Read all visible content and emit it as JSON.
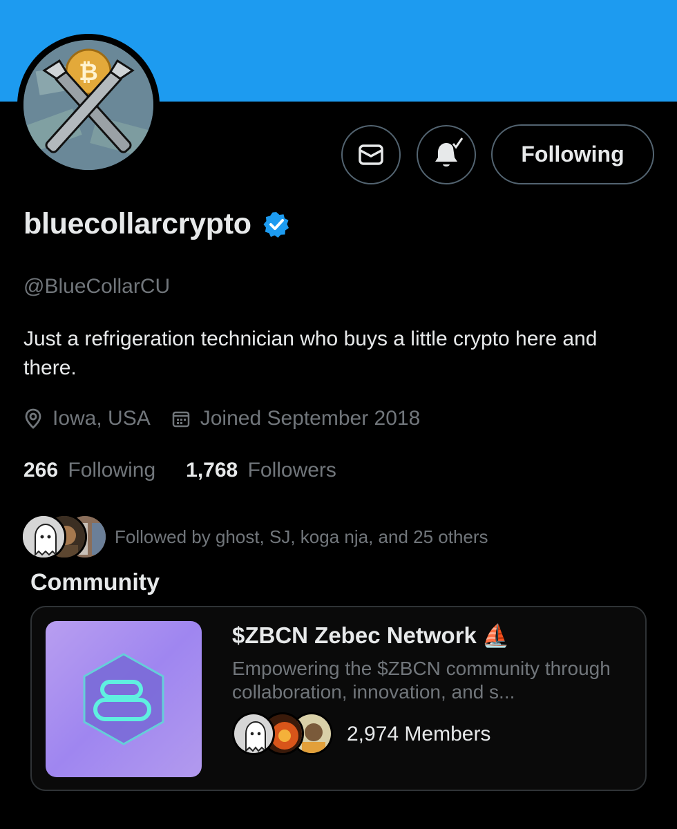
{
  "profile": {
    "display_name": "bluecollarcrypto",
    "handle": "@BlueCollarCU",
    "bio": "Just a refrigeration technician who buys a little crypto here and there.",
    "location": "Iowa, USA",
    "joined": "Joined September 2018",
    "verified": true,
    "avatar_icon": "bitcoin-crossed-wrenches-avatar"
  },
  "actions": {
    "message_icon": "envelope-icon",
    "notify_icon": "bell-check-icon",
    "follow_label": "Following"
  },
  "stats": {
    "following_count": "266",
    "following_label": "Following",
    "followers_count": "1,768",
    "followers_label": "Followers"
  },
  "followed_by": {
    "text": "Followed by ghost, SJ, koga nja, and 25 others"
  },
  "community": {
    "heading": "Community",
    "name": "$ZBCN Zebec Network",
    "emoji": "⛵",
    "description": "Empowering the $ZBCN community through collaboration, innovation, and s...",
    "members": "2,974 Members"
  },
  "colors": {
    "banner": "#1d9bf0",
    "verified": "#1d9bf0",
    "muted_text": "#71767b",
    "primary_text": "#e7e9ea",
    "border": "#536471"
  }
}
